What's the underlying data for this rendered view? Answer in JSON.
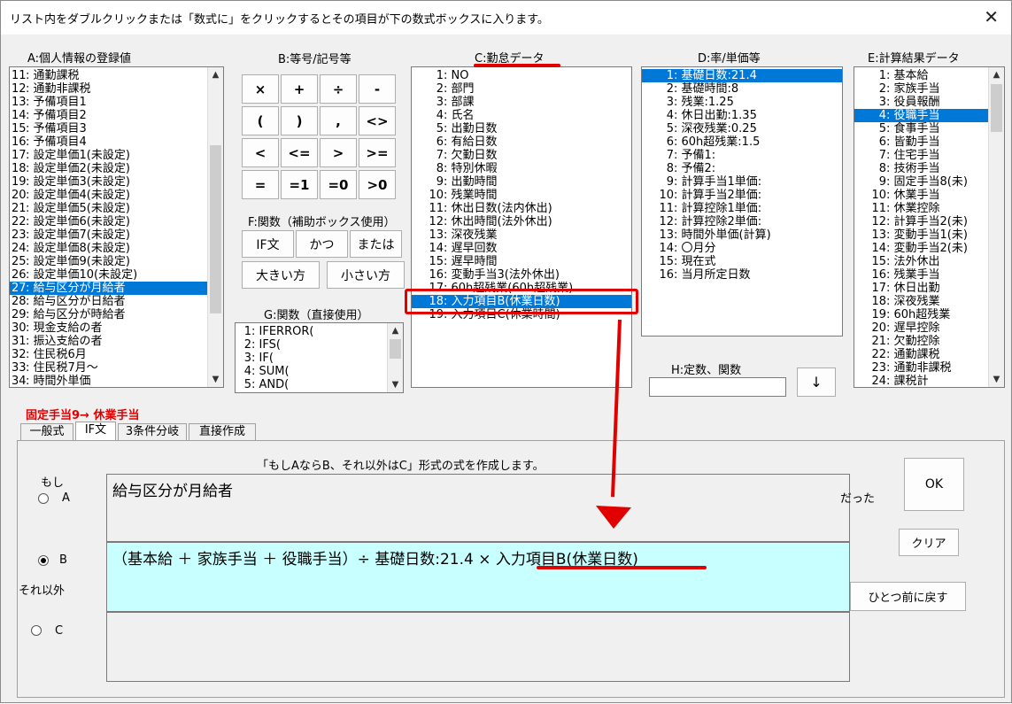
{
  "window": {
    "title": "リスト内をダブルクリックまたは「数式に」をクリックするとその項目が下の数式ボックスに入ります。",
    "close_glyph": "✕"
  },
  "sections": {
    "a": "A:個人情報の登録値",
    "b": "B:等号/記号等",
    "c": "C:勤怠データ",
    "d": "D:率/単価等",
    "e": "E:計算結果データ",
    "f": "F:関数（補助ボックス使用）",
    "g": "G:関数（直接使用）",
    "h": "H:定数、関数"
  },
  "list_a": [
    {
      "n": "11",
      "t": "通勤課税"
    },
    {
      "n": "12",
      "t": "通勤非課税"
    },
    {
      "n": "13",
      "t": "予備項目1"
    },
    {
      "n": "14",
      "t": "予備項目2"
    },
    {
      "n": "15",
      "t": "予備項目3"
    },
    {
      "n": "16",
      "t": "予備項目4"
    },
    {
      "n": "17",
      "t": "設定単価1(未設定)"
    },
    {
      "n": "18",
      "t": "設定単価2(未設定)"
    },
    {
      "n": "19",
      "t": "設定単価3(未設定)"
    },
    {
      "n": "20",
      "t": "設定単価4(未設定)"
    },
    {
      "n": "21",
      "t": "設定単価5(未設定)"
    },
    {
      "n": "22",
      "t": "設定単価6(未設定)"
    },
    {
      "n": "23",
      "t": "設定単価7(未設定)"
    },
    {
      "n": "24",
      "t": "設定単価8(未設定)"
    },
    {
      "n": "25",
      "t": "設定単価9(未設定)"
    },
    {
      "n": "26",
      "t": "設定単価10(未設定)"
    },
    {
      "n": "27",
      "t": "給与区分が月給者",
      "sel": true
    },
    {
      "n": "28",
      "t": "給与区分が日給者"
    },
    {
      "n": "29",
      "t": "給与区分が時給者"
    },
    {
      "n": "30",
      "t": "現金支給の者"
    },
    {
      "n": "31",
      "t": "振込支給の者"
    },
    {
      "n": "32",
      "t": "住民税6月"
    },
    {
      "n": "33",
      "t": "住民税7月～"
    },
    {
      "n": "34",
      "t": "時間外単価"
    }
  ],
  "list_c": [
    {
      "n": "1",
      "t": "NO"
    },
    {
      "n": "2",
      "t": "部門"
    },
    {
      "n": "3",
      "t": "部課"
    },
    {
      "n": "4",
      "t": "氏名"
    },
    {
      "n": "5",
      "t": "出勤日数"
    },
    {
      "n": "6",
      "t": "有給日数"
    },
    {
      "n": "7",
      "t": "欠勤日数"
    },
    {
      "n": "8",
      "t": "特別休暇"
    },
    {
      "n": "9",
      "t": "出勤時間"
    },
    {
      "n": "10",
      "t": "残業時間"
    },
    {
      "n": "11",
      "t": "休出日数(法内休出)"
    },
    {
      "n": "12",
      "t": "休出時間(法外休出)"
    },
    {
      "n": "13",
      "t": "深夜残業"
    },
    {
      "n": "14",
      "t": "遅早回数"
    },
    {
      "n": "15",
      "t": "遅早時間"
    },
    {
      "n": "16",
      "t": "変動手当3(法外休出)"
    },
    {
      "n": "17",
      "t": "60h超残業(60h超残業)"
    },
    {
      "n": "18",
      "t": "入力項目B(休業日数)",
      "sel": true
    },
    {
      "n": "19",
      "t": "入力項目C(休業時間)"
    }
  ],
  "list_d": [
    {
      "n": "1",
      "t": "基礎日数:21.4",
      "sel": true
    },
    {
      "n": "2",
      "t": "基礎時間:8"
    },
    {
      "n": "3",
      "t": "残業:1.25"
    },
    {
      "n": "4",
      "t": "休日出勤:1.35"
    },
    {
      "n": "5",
      "t": "深夜残業:0.25"
    },
    {
      "n": "6",
      "t": "60h超残業:1.5"
    },
    {
      "n": "7",
      "t": "予備1:"
    },
    {
      "n": "8",
      "t": "予備2:"
    },
    {
      "n": "9",
      "t": "計算手当1単価:"
    },
    {
      "n": "10",
      "t": "計算手当2単価:"
    },
    {
      "n": "11",
      "t": "計算控除1単価:"
    },
    {
      "n": "12",
      "t": "計算控除2単価:"
    },
    {
      "n": "13",
      "t": "時間外単価(計算)"
    },
    {
      "n": "14",
      "t": "〇月分"
    },
    {
      "n": "15",
      "t": "現在式"
    },
    {
      "n": "16",
      "t": "当月所定日数"
    }
  ],
  "list_e": [
    {
      "n": "1",
      "t": "基本給"
    },
    {
      "n": "2",
      "t": "家族手当"
    },
    {
      "n": "3",
      "t": "役員報酬"
    },
    {
      "n": "4",
      "t": "役職手当",
      "sel": true
    },
    {
      "n": "5",
      "t": "食事手当"
    },
    {
      "n": "6",
      "t": "皆勤手当"
    },
    {
      "n": "7",
      "t": "住宅手当"
    },
    {
      "n": "8",
      "t": "技術手当"
    },
    {
      "n": "9",
      "t": "固定手当8(未)"
    },
    {
      "n": "10",
      "t": "休業手当"
    },
    {
      "n": "11",
      "t": "休業控除"
    },
    {
      "n": "12",
      "t": "計算手当2(未)"
    },
    {
      "n": "13",
      "t": "変動手当1(未)"
    },
    {
      "n": "14",
      "t": "変動手当2(未)"
    },
    {
      "n": "15",
      "t": "法外休出"
    },
    {
      "n": "16",
      "t": "残業手当"
    },
    {
      "n": "17",
      "t": "休日出勤"
    },
    {
      "n": "18",
      "t": "深夜残業"
    },
    {
      "n": "19",
      "t": "60h超残業"
    },
    {
      "n": "20",
      "t": "遅早控除"
    },
    {
      "n": "21",
      "t": "欠勤控除"
    },
    {
      "n": "22",
      "t": "通勤課税"
    },
    {
      "n": "23",
      "t": "通勤非課税"
    },
    {
      "n": "24",
      "t": "課税計"
    }
  ],
  "list_g": [
    {
      "n": "1",
      "t": "IFERROR("
    },
    {
      "n": "2",
      "t": "IFS("
    },
    {
      "n": "3",
      "t": "IF("
    },
    {
      "n": "4",
      "t": "SUM("
    },
    {
      "n": "5",
      "t": "AND("
    }
  ],
  "symbol_buttons": [
    "×",
    "+",
    "÷",
    "-",
    "(",
    ")",
    ",",
    "<>",
    "<",
    "<=",
    ">",
    ">=",
    "=",
    "=1",
    "=0",
    ">0"
  ],
  "func_buttons": {
    "if": "IF文",
    "and": "かつ",
    "or": "または",
    "max": "大きい方",
    "min": "小さい方"
  },
  "h_value": "",
  "down_arrow": "↓",
  "status": "固定手当9→  休業手当",
  "tabs": [
    "一般式",
    "IF文",
    "3条件分岐",
    "直接作成"
  ],
  "active_tab": 1,
  "if_panel": {
    "description": "「もしAならB、それ以外はC」形式の式を作成します。",
    "moshi": "もし",
    "a_label": "A",
    "b_label": "B",
    "c_label": "C",
    "else_label": "それ以外",
    "datta": "だった",
    "field_a": "給与区分が月給者",
    "field_b": "（基本給 ＋ 家族手当 ＋ 役職手当）÷ 基礎日数:21.4 × 入力項目B(休業日数)",
    "field_c": "",
    "ok": "OK",
    "clear": "クリア",
    "undo": "ひとつ前に戻す",
    "selected": "B"
  },
  "colors": {
    "selection": "#0078d7",
    "annotation": "#e00000",
    "field_b_bg": "#c8ffff"
  }
}
